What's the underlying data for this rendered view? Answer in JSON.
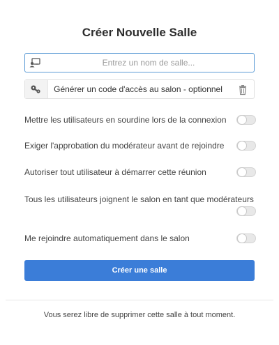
{
  "title": "Créer Nouvelle Salle",
  "room_name": {
    "value": "",
    "placeholder": "Entrez un nom de salle...",
    "icon": "chalkboard-user-icon"
  },
  "access_code": {
    "label": "Générer un code d'accès au salon - optionnel",
    "icon": "key-icon",
    "action_icon": "trash-icon"
  },
  "options": [
    {
      "label": "Mettre les utilisateurs en sourdine lors de la connexion",
      "enabled": false
    },
    {
      "label": "Exiger l'approbation du modérateur avant de rejoindre",
      "enabled": false
    },
    {
      "label": "Autoriser tout utilisateur à démarrer cette réunion",
      "enabled": false
    },
    {
      "label": "Tous les utilisateurs joignent le salon en tant que modérateurs",
      "enabled": false
    },
    {
      "label": "Me rejoindre automatiquement dans le salon",
      "enabled": false
    }
  ],
  "create_button": "Créer une salle",
  "footer": "Vous serez libre de supprimer cette salle à tout moment.",
  "colors": {
    "accent": "#3b7dd8",
    "focus_border": "#5b9bd5",
    "toggle_off": "#e8e8e8"
  }
}
